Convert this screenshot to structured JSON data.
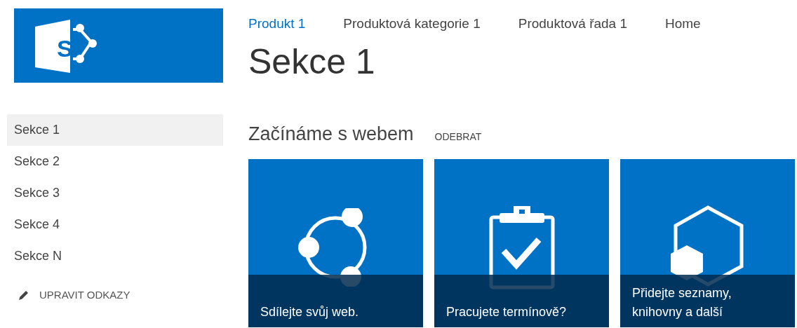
{
  "top_nav": [
    {
      "label": "Produkt 1",
      "selected": true
    },
    {
      "label": "Produktová kategorie 1",
      "selected": false
    },
    {
      "label": "Produktová řada 1",
      "selected": false
    },
    {
      "label": "Home",
      "selected": false
    }
  ],
  "logo_letter": "S",
  "page_title": "Sekce 1",
  "sidebar": {
    "items": [
      {
        "label": "Sekce 1",
        "selected": true
      },
      {
        "label": "Sekce 2",
        "selected": false
      },
      {
        "label": "Sekce 3",
        "selected": false
      },
      {
        "label": "Sekce 4",
        "selected": false
      },
      {
        "label": "Sekce N",
        "selected": false
      }
    ],
    "edit_links": "UPRAVIT ODKAZY"
  },
  "getting_started": {
    "title": "Začínáme s webem",
    "remove": "ODEBRAT",
    "tiles": [
      {
        "kind": "share",
        "label": "Sdílejte svůj web."
      },
      {
        "kind": "clipboard",
        "label": "Pracujete termínově?"
      },
      {
        "kind": "apps",
        "label": "Přidejte seznamy, knihovny a další"
      }
    ]
  }
}
